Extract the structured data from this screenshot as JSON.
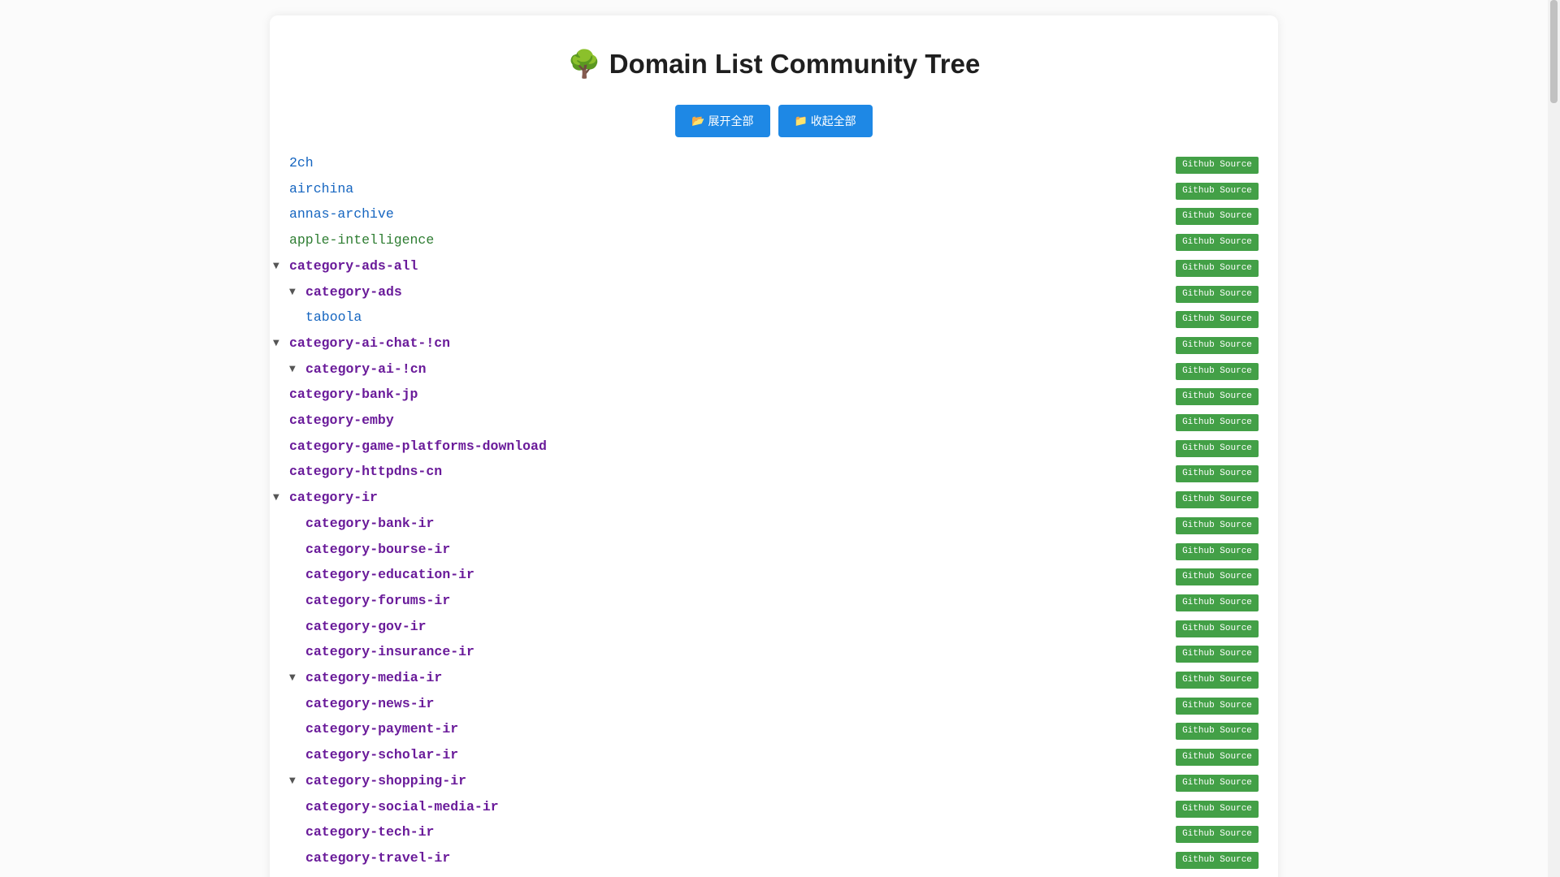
{
  "title": "Domain List Community Tree",
  "title_icon": "🌳",
  "toolbar": {
    "expand_all": {
      "icon": "📂",
      "label": "展开全部"
    },
    "collapse_all": {
      "icon": "📁",
      "label": "收起全部"
    }
  },
  "source_label": "Github Source",
  "colors": {
    "button": "#1e88e5",
    "source_badge": "#43a047",
    "leaf_blue": "#1565c0",
    "leaf_green": "#2e7d32",
    "category_purple": "#6a1b9a"
  },
  "items": [
    {
      "name": "2ch",
      "level": 0,
      "style": "blue",
      "expanded": null
    },
    {
      "name": "airchina",
      "level": 0,
      "style": "blue",
      "expanded": null
    },
    {
      "name": "annas-archive",
      "level": 0,
      "style": "blue",
      "expanded": null
    },
    {
      "name": "apple-intelligence",
      "level": 0,
      "style": "green",
      "expanded": null
    },
    {
      "name": "category-ads-all",
      "level": 0,
      "style": "purple",
      "expanded": true
    },
    {
      "name": "category-ads",
      "level": 1,
      "style": "purple",
      "expanded": true
    },
    {
      "name": "taboola",
      "level": 1,
      "style": "blue",
      "expanded": null
    },
    {
      "name": "category-ai-chat-!cn",
      "level": 0,
      "style": "purple",
      "expanded": true
    },
    {
      "name": "category-ai-!cn",
      "level": 1,
      "style": "purple",
      "expanded": true
    },
    {
      "name": "category-bank-jp",
      "level": 0,
      "style": "purple",
      "expanded": null
    },
    {
      "name": "category-emby",
      "level": 0,
      "style": "purple",
      "expanded": null
    },
    {
      "name": "category-game-platforms-download",
      "level": 0,
      "style": "purple",
      "expanded": null
    },
    {
      "name": "category-httpdns-cn",
      "level": 0,
      "style": "purple",
      "expanded": null
    },
    {
      "name": "category-ir",
      "level": 0,
      "style": "purple",
      "expanded": true
    },
    {
      "name": "category-bank-ir",
      "level": 1,
      "style": "purple",
      "expanded": null
    },
    {
      "name": "category-bourse-ir",
      "level": 1,
      "style": "purple",
      "expanded": null
    },
    {
      "name": "category-education-ir",
      "level": 1,
      "style": "purple",
      "expanded": null
    },
    {
      "name": "category-forums-ir",
      "level": 1,
      "style": "purple",
      "expanded": null
    },
    {
      "name": "category-gov-ir",
      "level": 1,
      "style": "purple",
      "expanded": null
    },
    {
      "name": "category-insurance-ir",
      "level": 1,
      "style": "purple",
      "expanded": null
    },
    {
      "name": "category-media-ir",
      "level": 1,
      "style": "purple",
      "expanded": true
    },
    {
      "name": "category-news-ir",
      "level": 1,
      "style": "purple",
      "expanded": null
    },
    {
      "name": "category-payment-ir",
      "level": 1,
      "style": "purple",
      "expanded": null
    },
    {
      "name": "category-scholar-ir",
      "level": 1,
      "style": "purple",
      "expanded": null
    },
    {
      "name": "category-shopping-ir",
      "level": 1,
      "style": "purple",
      "expanded": true
    },
    {
      "name": "category-social-media-ir",
      "level": 1,
      "style": "purple",
      "expanded": null
    },
    {
      "name": "category-tech-ir",
      "level": 1,
      "style": "purple",
      "expanded": null
    },
    {
      "name": "category-travel-ir",
      "level": 1,
      "style": "purple",
      "expanded": null
    },
    {
      "name": "",
      "level": 1,
      "style": "purple",
      "expanded": null
    }
  ]
}
